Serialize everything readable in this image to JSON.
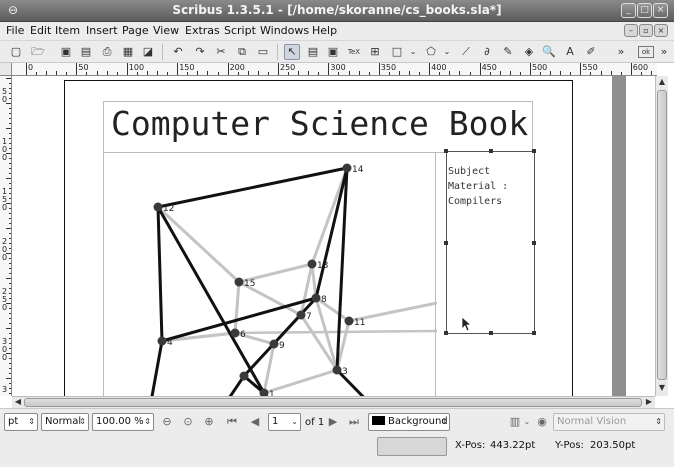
{
  "window": {
    "title": "Scribus 1.3.5.1 - [/home/skoranne/cs_books.sla*]",
    "buttons": [
      "_",
      "□",
      "×"
    ]
  },
  "menu": {
    "items": [
      "File",
      "Edit",
      "Item",
      "Insert",
      "Page",
      "View",
      "Extras",
      "Script",
      "Windows",
      "Help"
    ]
  },
  "ruler": {
    "h_labels": [
      "0",
      "50",
      "100",
      "150",
      "200",
      "250",
      "300",
      "350",
      "400",
      "450",
      "500",
      "550",
      "600"
    ],
    "v_labels": [
      "5",
      "0",
      "1",
      "0",
      "0",
      "1",
      "5",
      "0",
      "2",
      "0",
      "0",
      "2",
      "5",
      "0",
      "3",
      "0",
      "0",
      "3"
    ]
  },
  "document": {
    "title_text": "Computer Science Book",
    "text_frame_lines": [
      "Subject",
      "Material :",
      "Compilers"
    ],
    "node_labels": [
      "14",
      "12",
      "15",
      "13",
      "8",
      "7",
      "11",
      "6",
      "9",
      "4",
      "3",
      "1"
    ]
  },
  "status": {
    "unit": "pt",
    "mode": "Normal",
    "zoom": "100.00 %",
    "page_number": "1",
    "page_of": "of 1",
    "layer": "Background",
    "vision": "Normal Vision"
  },
  "coords": {
    "x_label": "X-Pos:",
    "x_value": "443.22pt",
    "y_label": "Y-Pos:",
    "y_value": "203.50pt"
  },
  "colors": {
    "titlebar": "#6e6e6e",
    "chrome": "#ececec",
    "layer_swatch": "#000000"
  }
}
